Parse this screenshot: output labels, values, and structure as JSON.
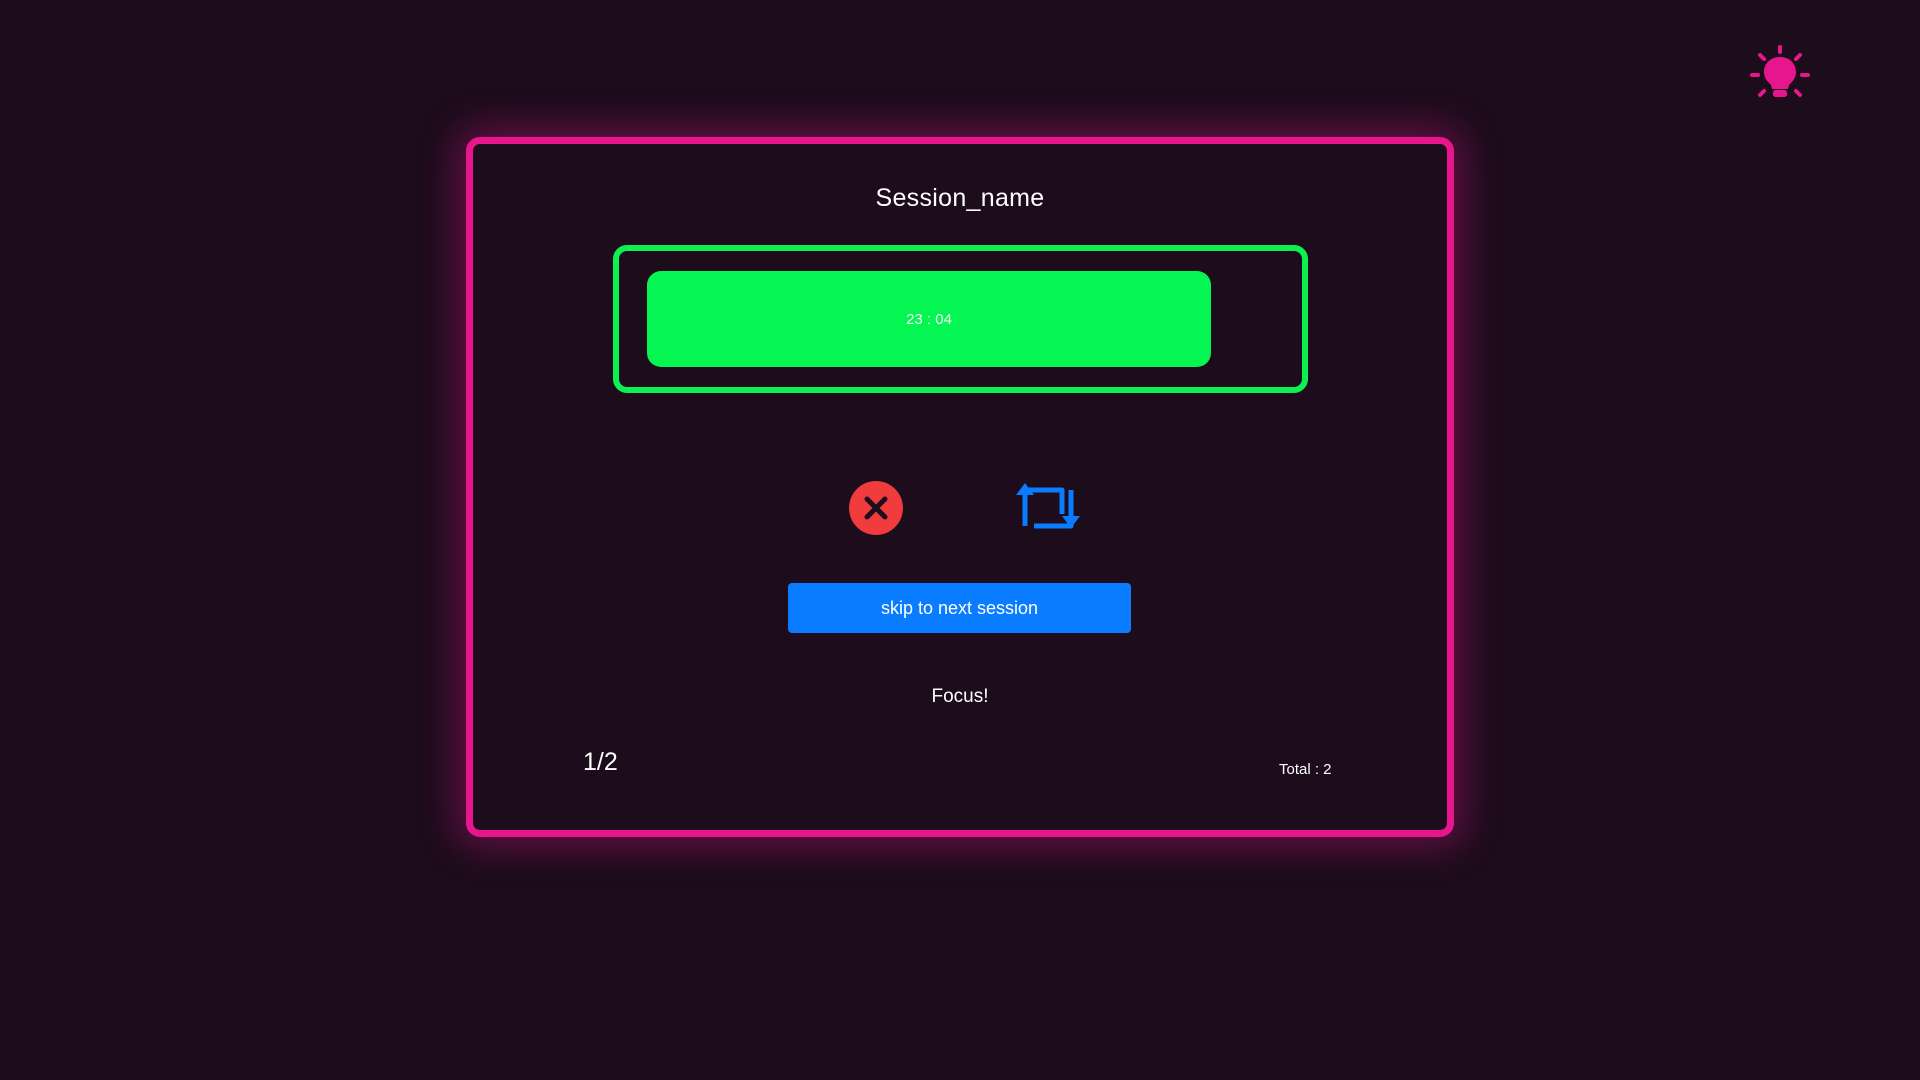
{
  "header": {
    "theme_toggle_icon": "lightbulb-icon",
    "theme_toggle_color": "#e8168c"
  },
  "session": {
    "name": "Session_name",
    "timer": {
      "display": "23 : 04",
      "progress": 0.9,
      "bar_color": "#05f552",
      "frame_color": "#0cf052"
    },
    "controls": {
      "stop_icon": "close-circle-icon",
      "stop_color": "#f03c3c",
      "restart_icon": "repeat-icon",
      "restart_color": "#0a7cff",
      "skip_label": "skip to next session"
    },
    "status": "Focus!",
    "counter": "1/2",
    "total": "Total : 2"
  },
  "colors": {
    "background": "#1c0c1c",
    "accent": "#e8168c",
    "primary_button": "#0a7cff"
  }
}
